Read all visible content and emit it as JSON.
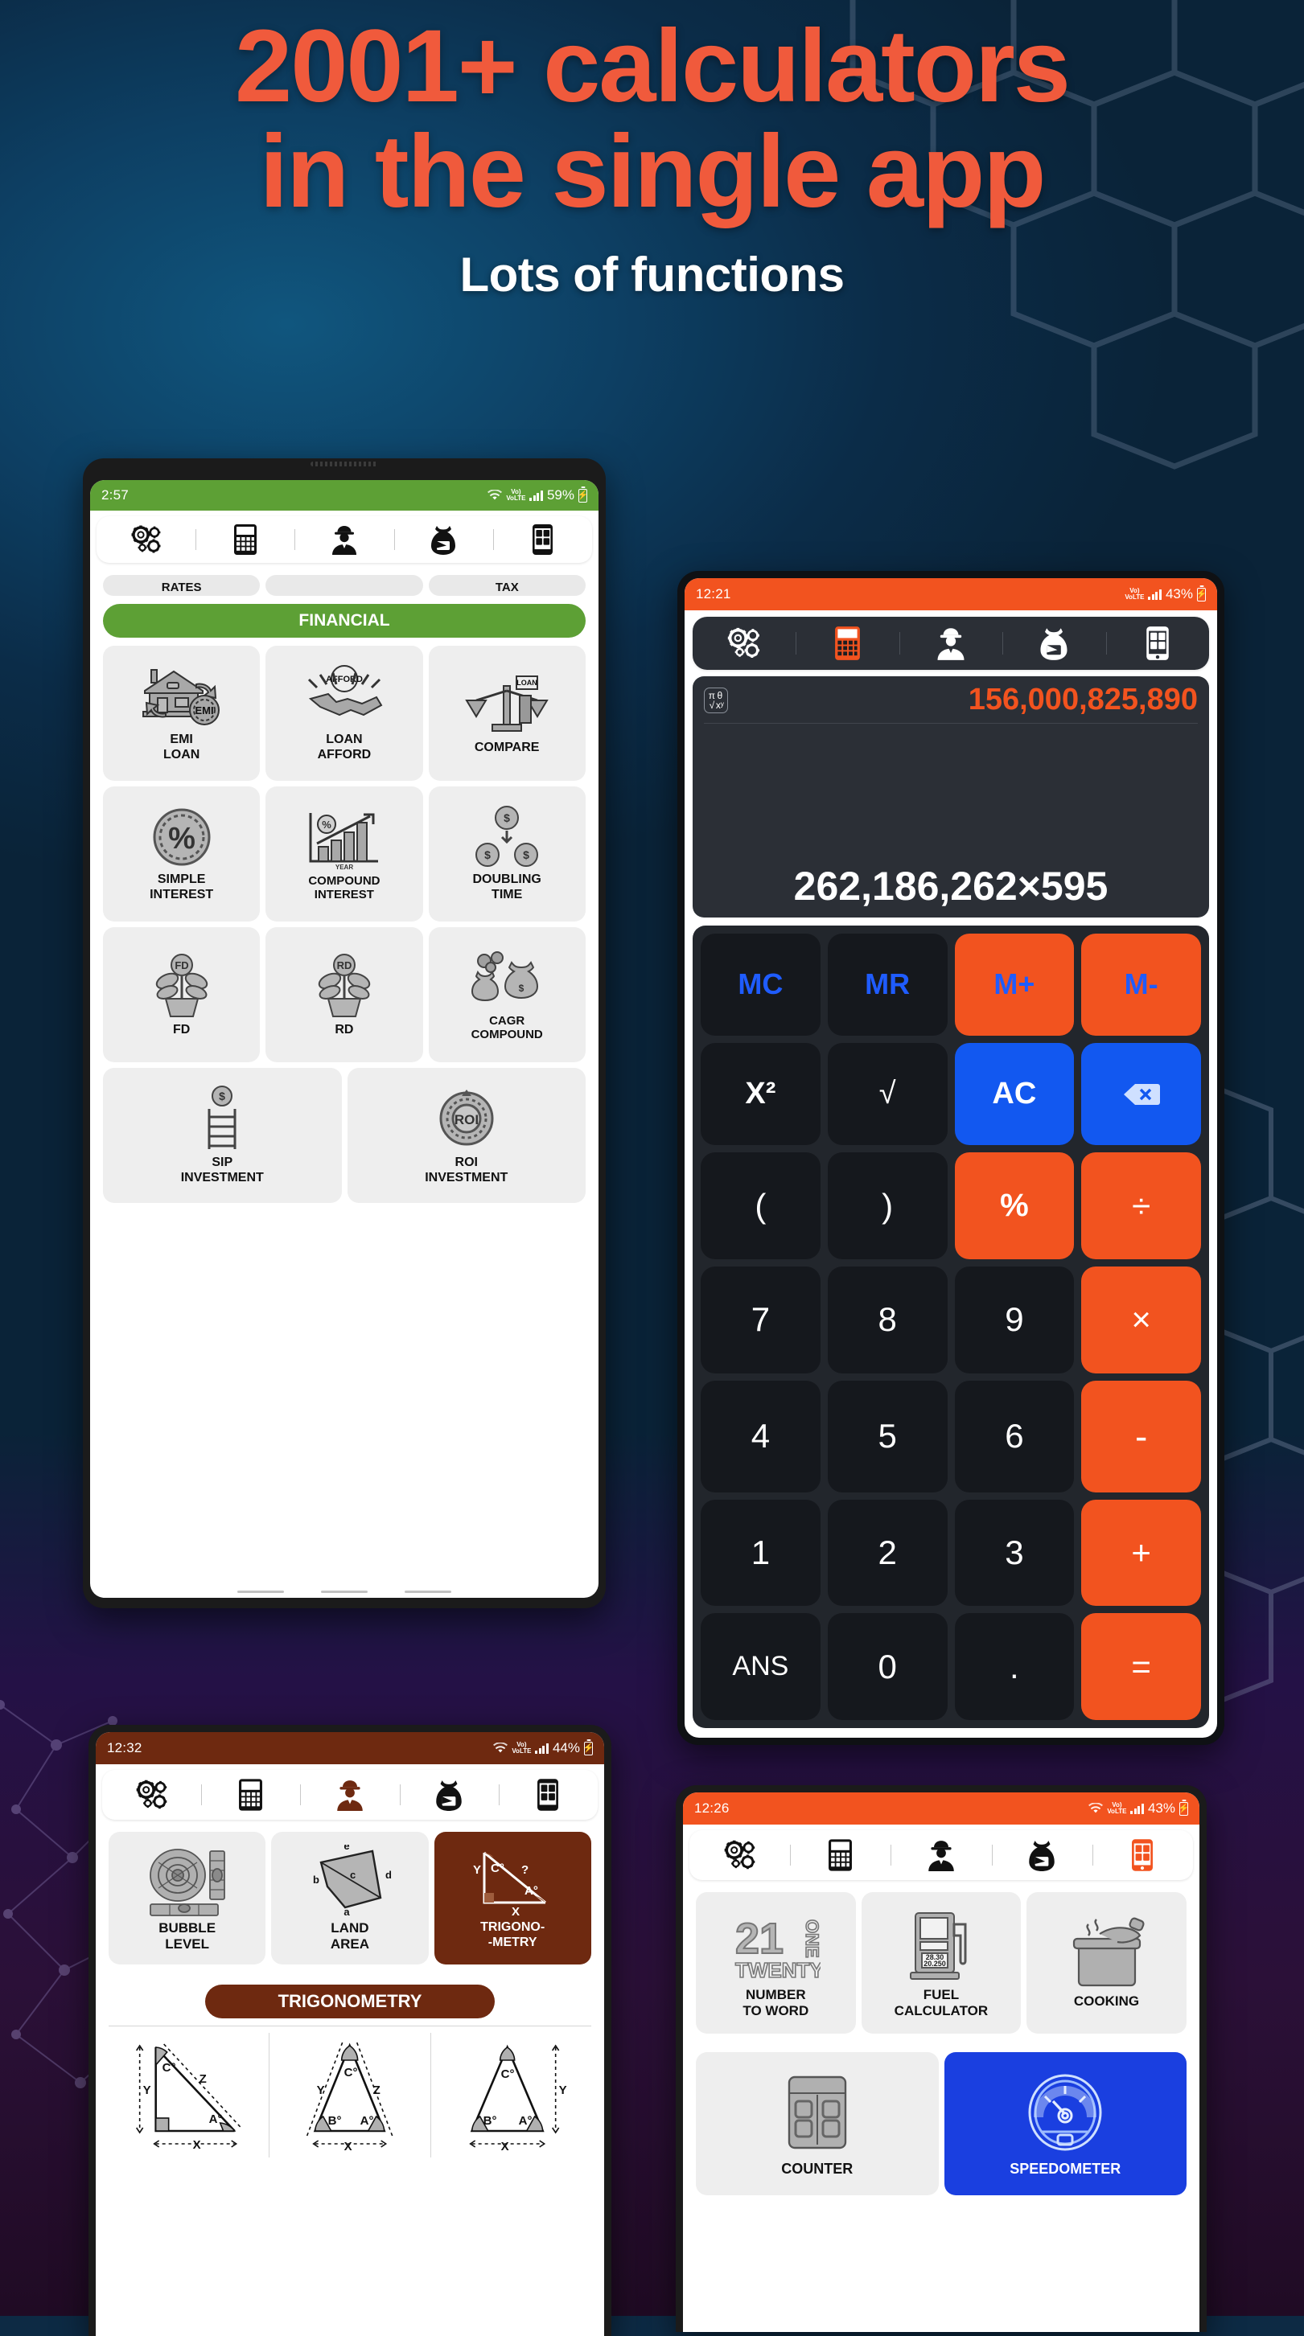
{
  "poster": {
    "headline_line1": "2001+ calculators",
    "headline_line2": "in the single app",
    "subheadline": "Lots of functions",
    "headline_color": "#f05a3c",
    "background_color": "#0d2a44"
  },
  "phone1": {
    "theme_color": "#5da035",
    "status": {
      "time": "2:57",
      "network": "VoLTE",
      "battery_percent": "59%"
    },
    "toolbar": [
      {
        "name": "settings-gears-icon",
        "label": "Settings"
      },
      {
        "name": "calculator-icon",
        "label": "Calculator"
      },
      {
        "name": "engineer-icon",
        "label": "Engineer"
      },
      {
        "name": "finance-bag-icon",
        "label": "Finance"
      },
      {
        "name": "tools-phone-icon",
        "label": "Tools"
      }
    ],
    "top_chips": [
      "RATES",
      "",
      "TAX"
    ],
    "section_title": "FINANCIAL",
    "tiles": [
      {
        "icon": "house-emi-icon",
        "label": "EMI\nLOAN"
      },
      {
        "icon": "handshake-afford-icon",
        "label": "LOAN\nAFFORD"
      },
      {
        "icon": "compare-loan-icon",
        "label": "COMPARE"
      },
      {
        "icon": "percent-circle-icon",
        "label": "SIMPLE\nINTEREST"
      },
      {
        "icon": "growth-chart-icon",
        "label": "COMPOUND\nINTEREST"
      },
      {
        "icon": "doubling-coins-icon",
        "label": "DOUBLING\nTIME"
      },
      {
        "icon": "fd-plant-icon",
        "label": "FD"
      },
      {
        "icon": "rd-plant-icon",
        "label": "RD"
      },
      {
        "icon": "cagr-bags-icon",
        "label": "CAGR\nCOMPOUND"
      },
      {
        "icon": "sip-ladder-icon",
        "label": "SIP\nINVESTMENT"
      },
      {
        "icon": "roi-circle-icon",
        "label": "ROI\nINVESTMENT"
      }
    ]
  },
  "phone2": {
    "theme_color": "#f2531f",
    "status": {
      "time": "12:21",
      "network": "VoLTE",
      "battery_percent": "43%"
    },
    "toolbar": [
      {
        "name": "settings-gears-icon",
        "label": "Settings"
      },
      {
        "name": "calculator-icon",
        "label": "Calculator",
        "active": true
      },
      {
        "name": "engineer-icon",
        "label": "Engineer"
      },
      {
        "name": "finance-bag-icon",
        "label": "Finance"
      },
      {
        "name": "tools-phone-icon",
        "label": "Tools"
      }
    ],
    "display": {
      "result": "156,000,825,890",
      "expression": "262,186,262×595",
      "sci_toggle": [
        "π",
        "θ",
        "√",
        "xʸ"
      ]
    },
    "keys": [
      {
        "label": "MC",
        "style": "memtxt"
      },
      {
        "label": "MR",
        "style": "memtxt"
      },
      {
        "label": "M+",
        "style": "orange memtxt"
      },
      {
        "label": "M-",
        "style": "orange memtxt"
      },
      {
        "label": "X²",
        "style": ""
      },
      {
        "label": "√",
        "style": ""
      },
      {
        "label": "AC",
        "style": "blue"
      },
      {
        "label": "backspace-icon",
        "style": "blue",
        "icon": true
      },
      {
        "label": "(",
        "style": ""
      },
      {
        "label": ")",
        "style": ""
      },
      {
        "label": "%",
        "style": "orange"
      },
      {
        "label": "÷",
        "style": "orange"
      },
      {
        "label": "7",
        "style": ""
      },
      {
        "label": "8",
        "style": ""
      },
      {
        "label": "9",
        "style": ""
      },
      {
        "label": "×",
        "style": "orange"
      },
      {
        "label": "4",
        "style": ""
      },
      {
        "label": "5",
        "style": ""
      },
      {
        "label": "6",
        "style": ""
      },
      {
        "label": "-",
        "style": "orange"
      },
      {
        "label": "1",
        "style": ""
      },
      {
        "label": "2",
        "style": ""
      },
      {
        "label": "3",
        "style": ""
      },
      {
        "label": "+",
        "style": "orange"
      },
      {
        "label": "ANS",
        "style": ""
      },
      {
        "label": "0",
        "style": ""
      },
      {
        "label": ".",
        "style": ""
      },
      {
        "label": "=",
        "style": "orange"
      }
    ]
  },
  "phone3": {
    "theme_color": "#6e2910",
    "status": {
      "time": "12:32",
      "network": "VoLTE",
      "battery_percent": "44%"
    },
    "toolbar": [
      {
        "name": "settings-gears-icon",
        "label": "Settings"
      },
      {
        "name": "calculator-icon",
        "label": "Calculator"
      },
      {
        "name": "engineer-icon",
        "label": "Engineer",
        "active": true
      },
      {
        "name": "finance-bag-icon",
        "label": "Finance"
      },
      {
        "name": "tools-phone-icon",
        "label": "Tools"
      }
    ],
    "tiles": [
      {
        "icon": "bubble-level-icon",
        "label": "BUBBLE\nLEVEL",
        "accent": false
      },
      {
        "icon": "land-area-icon",
        "label": "LAND\nAREA",
        "accent": false
      },
      {
        "icon": "trigonometry-icon",
        "label": "TRIGONO-\n-METRY",
        "accent": true
      }
    ],
    "land_area_labels": [
      "a",
      "b",
      "c",
      "d",
      "e"
    ],
    "trig_tile_labels": [
      "Y",
      "C°",
      "?",
      "A°",
      "X"
    ],
    "section_title": "TRIGONOMETRY",
    "triangles": [
      {
        "name": "right-triangle-diagram",
        "labels": [
          "C°",
          "Z",
          "A°",
          "Y",
          "X"
        ]
      },
      {
        "name": "isosceles-triangle-diagram",
        "labels": [
          "C°",
          "Y",
          "Z",
          "B°",
          "A°",
          "X"
        ]
      },
      {
        "name": "triangle-height-diagram",
        "labels": [
          "C°",
          "B°",
          "A°",
          "Y",
          "X"
        ]
      }
    ]
  },
  "phone4": {
    "theme_color": "#f2531f",
    "status": {
      "time": "12:26",
      "network": "VoLTE",
      "battery_percent": "43%"
    },
    "toolbar": [
      {
        "name": "settings-gears-icon",
        "label": "Settings"
      },
      {
        "name": "calculator-icon",
        "label": "Calculator"
      },
      {
        "name": "engineer-icon",
        "label": "Engineer"
      },
      {
        "name": "finance-bag-icon",
        "label": "Finance"
      },
      {
        "name": "tools-phone-icon",
        "label": "Tools",
        "active": true
      }
    ],
    "tiles": [
      {
        "icon": "number-to-word-icon",
        "label": "NUMBER\nTO WORD",
        "accent": false,
        "glyphs": [
          "21",
          "TWENTY",
          "ONE"
        ]
      },
      {
        "icon": "fuel-pump-icon",
        "label": "FUEL\nCALCULATOR",
        "accent": false,
        "readout": [
          "28.30",
          "20.250"
        ]
      },
      {
        "icon": "cooking-pot-icon",
        "label": "COOKING",
        "accent": false
      },
      {
        "icon": "counter-icon",
        "label": "COUNTER",
        "accent": false
      },
      {
        "icon": "speedometer-icon",
        "label": "SPEEDOMETER",
        "accent": true
      }
    ],
    "accent_tile_color": "#1a3fe0"
  }
}
